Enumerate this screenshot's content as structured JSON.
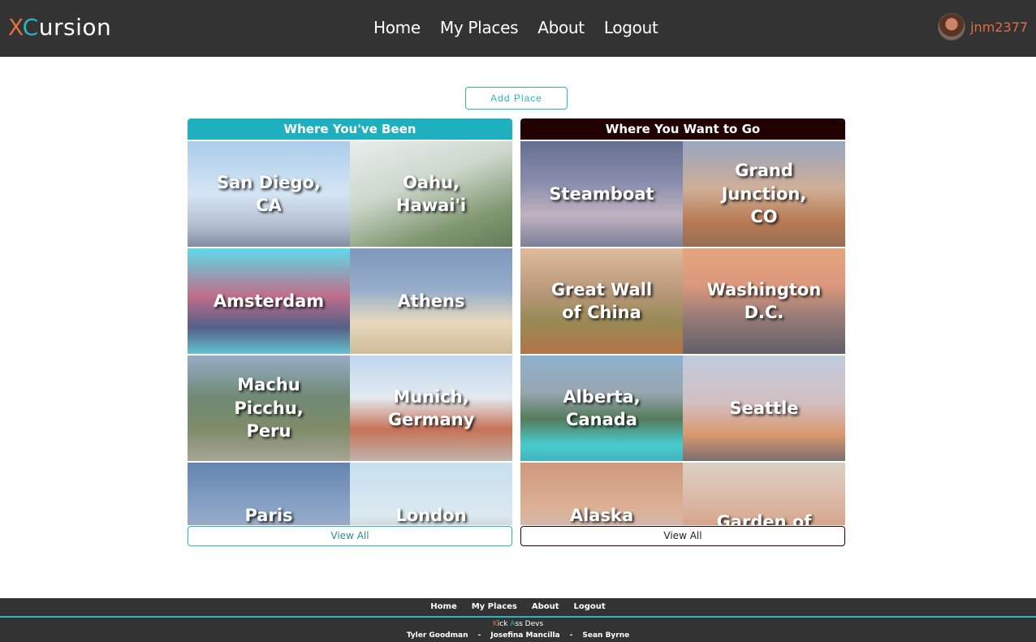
{
  "header": {
    "logo_x": "X",
    "logo_c": "C",
    "logo_rest": "ursion",
    "nav": [
      "Home",
      "My Places",
      "About",
      "Logout"
    ],
    "username": "jnm2377"
  },
  "add_place_label": "Add Place",
  "been": {
    "title": "Where You've Been",
    "places": [
      "San Diego, CA",
      "Oahu, Hawai'i",
      "Amsterdam",
      "Athens",
      "Machu Picchu, Peru",
      "Munich, Germany",
      "Paris",
      "London"
    ],
    "view_all": "View All"
  },
  "want": {
    "title": "Where You Want to Go",
    "places": [
      "Steamboat",
      "Grand Junction, CO",
      "Great Wall of China",
      "Washington D.C.",
      "Alberta, Canada",
      "Seattle",
      "Alaska",
      "Garden of the Gods"
    ],
    "view_all": "View All"
  },
  "footer": {
    "nav": [
      "Home",
      "My Places",
      "About",
      "Logout"
    ],
    "brand_k": "K",
    "brand_mid": "ick ",
    "brand_a": "A",
    "brand_rest": "ss Devs",
    "credits": [
      "Tyler Goodman",
      "Josefina Mancilla",
      "Sean Byrne"
    ],
    "separator": "-"
  },
  "colors": {
    "header_bg": "#333333",
    "accent_teal": "#2bb5c4",
    "accent_orange": "#e0703c",
    "want_header": "#220000"
  }
}
